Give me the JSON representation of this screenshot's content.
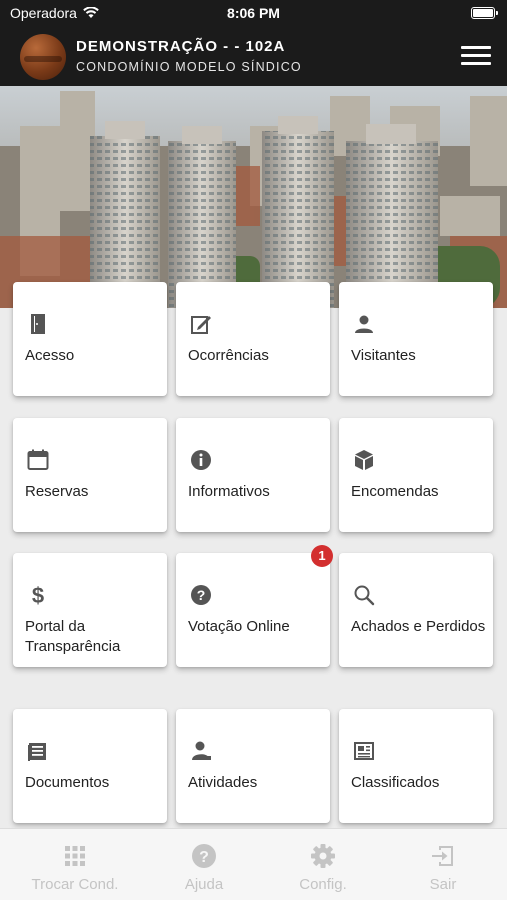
{
  "status": {
    "carrier": "Operadora",
    "time": "8:06 PM"
  },
  "header": {
    "title": "DEMONSTRAÇÃO - - 102A",
    "subtitle": "CONDOMÍNIO MODELO SÍNDICO"
  },
  "grid": [
    {
      "label": "Acesso",
      "icon": "door-icon"
    },
    {
      "label": "Ocorrências",
      "icon": "edit-icon"
    },
    {
      "label": "Visitantes",
      "icon": "person-icon"
    },
    {
      "label": "Reservas",
      "icon": "calendar-icon"
    },
    {
      "label": "Informativos",
      "icon": "info-icon"
    },
    {
      "label": "Encomendas",
      "icon": "package-icon"
    },
    {
      "label": "Portal da Transparência",
      "icon": "dollar-icon"
    },
    {
      "label": "Votação Online",
      "icon": "question-icon",
      "badge": "1"
    },
    {
      "label": "Achados e Perdidos",
      "icon": "search-icon"
    },
    {
      "label": "Documentos",
      "icon": "document-icon"
    },
    {
      "label": "Atividades",
      "icon": "person-activity-icon"
    },
    {
      "label": "Classificados",
      "icon": "newspaper-icon"
    }
  ],
  "bottom_nav": [
    {
      "label": "Trocar Cond.",
      "icon": "grid-icon"
    },
    {
      "label": "Ajuda",
      "icon": "help-icon"
    },
    {
      "label": "Config.",
      "icon": "gear-icon"
    },
    {
      "label": "Sair",
      "icon": "exit-icon"
    }
  ],
  "colors": {
    "header": "#1b1b1b",
    "badge": "#d32f2f",
    "icon": "#555555",
    "nav_inactive": "#c4c4c4"
  }
}
